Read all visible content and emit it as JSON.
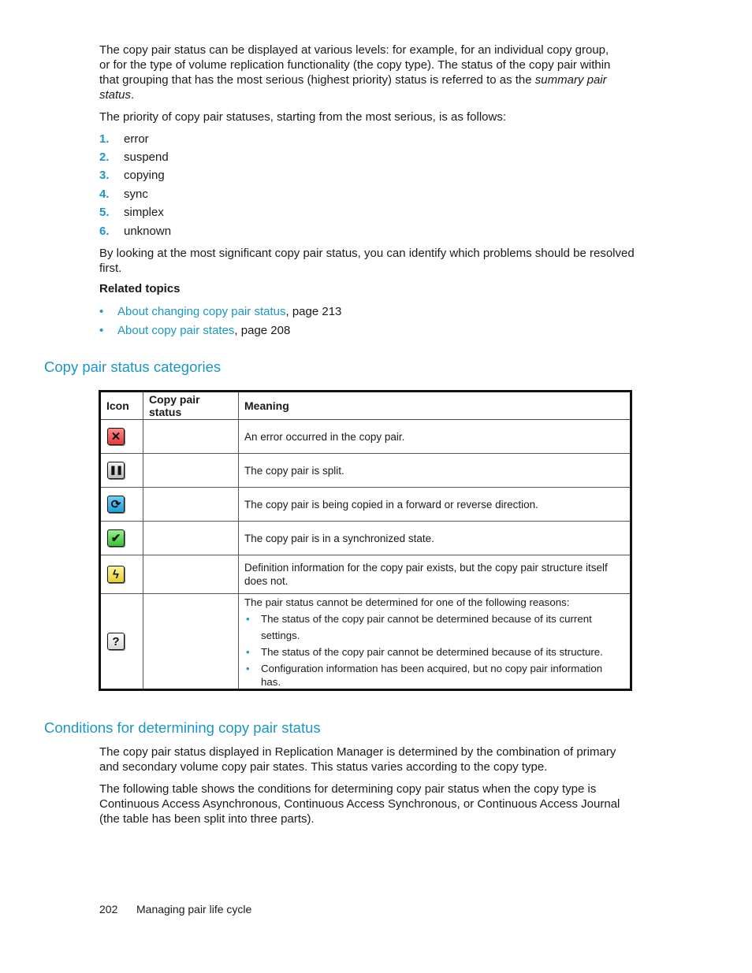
{
  "intro": {
    "p1_line1": "The copy pair status can be displayed at various levels: for example, for an individual copy group,",
    "p1_line2": "or for the type of volume replication functionality (the copy type). The status of the copy pair within",
    "p1_line3_pre": "that grouping that has the most serious (highest priority) status is referred to as the ",
    "p1_line3_em": "summary pair",
    "p1_line4_em": "status",
    "p1_line4_post": ".",
    "p2": "The priority of copy pair statuses, starting from the most serious, is as follows:"
  },
  "priority_list": [
    {
      "num": "1.",
      "label": "error"
    },
    {
      "num": "2.",
      "label": "suspend"
    },
    {
      "num": "3.",
      "label": "copying"
    },
    {
      "num": "4.",
      "label": "sync"
    },
    {
      "num": "5.",
      "label": "simplex"
    },
    {
      "num": "6.",
      "label": "unknown"
    }
  ],
  "p3_line1": "By looking at the most significant copy pair status, you can identify which problems should be resolved",
  "p3_line2": "first.",
  "related": {
    "heading": "Related topics",
    "items": [
      {
        "link": "About changing copy pair status",
        "suffix": ", page 213"
      },
      {
        "link": "About copy pair states",
        "suffix": ", page 208"
      }
    ]
  },
  "section1": {
    "heading": "Copy pair status categories",
    "table": {
      "headers": [
        "Icon",
        "Copy pair status",
        "Meaning"
      ],
      "rows": [
        {
          "icon": "error-icon",
          "glyph": "✕",
          "status": "",
          "meaning": "An error occurred in the copy pair."
        },
        {
          "icon": "suspend-icon",
          "glyph": "❚❚",
          "status": "",
          "meaning": "The copy pair is split."
        },
        {
          "icon": "copying-icon",
          "glyph": "⟳",
          "status": "",
          "meaning": "The copy pair is being copied in a forward or reverse direction."
        },
        {
          "icon": "sync-icon",
          "glyph": "✔",
          "status": "",
          "meaning": "The copy pair is in a synchronized state."
        },
        {
          "icon": "simplex-icon",
          "glyph": "ϟ",
          "status": "",
          "meaning_line1": "Definition information for the copy pair exists, but the copy pair structure itself",
          "meaning_line2": "does not."
        },
        {
          "icon": "unknown-icon",
          "glyph": "?",
          "status": "",
          "meaning_intro": "The pair status cannot be determined for one of the following reasons:",
          "bullets": [
            "The status of the copy pair cannot be determined because of its current settings.",
            "The status of the copy pair cannot be determined because of its structure.",
            "Configuration information has been acquired, but no copy pair information"
          ],
          "bullet3_cont": "has."
        }
      ]
    }
  },
  "section2": {
    "heading": "Conditions for determining copy pair status",
    "p1_line1": "The copy pair status displayed in Replication Manager is determined by the combination of primary",
    "p1_line2": "and secondary volume copy pair states. This status varies according to the copy type.",
    "p2_line1": "The following table shows the conditions for determining copy pair status when the copy type is",
    "p2_line2": "Continuous Access Asynchronous, Continuous Access Synchronous, or Continuous Access Journal",
    "p2_line3": "(the table has been split into three parts)."
  },
  "footer": {
    "page_number": "202",
    "chapter": "Managing pair life cycle"
  }
}
